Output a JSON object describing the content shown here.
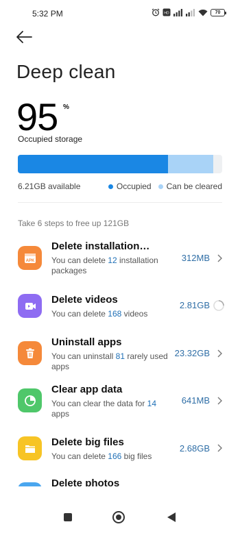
{
  "status": {
    "time": "5:32 PM",
    "battery": "70"
  },
  "header": {
    "back_icon": "arrow-left-icon",
    "title": "Deep clean"
  },
  "storage": {
    "percent": "95",
    "percent_sign": "%",
    "label": "Occupied storage",
    "occupied_fraction": 0.735,
    "clearable_fraction": 0.22,
    "available": "6.21GB available",
    "legend_occupied": "Occupied",
    "legend_clearable": "Can be cleared",
    "color_occupied": "#1a87e4",
    "color_clearable": "#a9d3f7"
  },
  "steps_title": "Take 6 steps to free up 121GB",
  "items": [
    {
      "title": "Delete installation…",
      "desc_pre": "You can delete ",
      "desc_num": "12",
      "desc_post": " installation packages",
      "size": "312MB",
      "icon": "apk-package-icon",
      "color": "#f5893a",
      "state": "chevron"
    },
    {
      "title": "Delete videos",
      "desc_pre": "You can delete ",
      "desc_num": "168",
      "desc_post": " videos",
      "size": "2.81GB",
      "icon": "video-camera-icon",
      "color": "#8e6cf2",
      "state": "loading"
    },
    {
      "title": "Uninstall apps",
      "desc_pre": "You can uninstall ",
      "desc_num": "81",
      "desc_post": " rarely used apps",
      "size": "23.32GB",
      "icon": "trash-icon",
      "color": "#f5893a",
      "state": "chevron"
    },
    {
      "title": "Clear app data",
      "desc_pre": "You can clear the data for ",
      "desc_num": "14",
      "desc_post": " apps",
      "size": "641MB",
      "icon": "pie-chart-icon",
      "color": "#4fc76a",
      "state": "chevron"
    },
    {
      "title": "Delete big files",
      "desc_pre": "You can delete ",
      "desc_num": "166",
      "desc_post": " big files",
      "size": "2.68GB",
      "icon": "folder-icon",
      "color": "#f7c425",
      "state": "chevron"
    },
    {
      "title": "Delete photos",
      "icon": "photo-icon",
      "color": "#4aa6ef"
    }
  ]
}
